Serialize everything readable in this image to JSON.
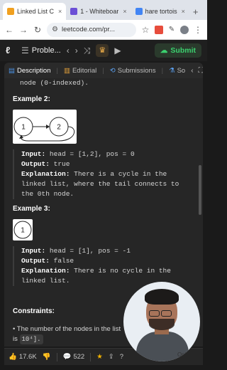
{
  "browser": {
    "tabs": [
      {
        "label": "Linked List C",
        "favicon_color": "#f0a020",
        "active": true
      },
      {
        "label": "1 - Whiteboar",
        "favicon_color": "#6b4fd6",
        "active": false
      },
      {
        "label": "hare tortois",
        "favicon_color": "#4285f4",
        "active": false
      }
    ],
    "tab_close": "×",
    "new_tab": "+",
    "address": {
      "url": "leetcode.com/pr...",
      "back": "←",
      "forward": "→",
      "reload": "↻",
      "star": "☆",
      "menu": "⋮"
    }
  },
  "leetcode": {
    "problem_list_label": "Proble...",
    "prev": "‹",
    "next": "›",
    "shuffle": "⤨",
    "run": "▶",
    "submit_label": "Submit",
    "submit_color": "#3bd16f"
  },
  "panel": {
    "tabs": [
      {
        "label": "Description",
        "icon": "description-icon",
        "active": true
      },
      {
        "label": "Editorial",
        "icon": "editorial-icon",
        "active": false
      },
      {
        "label": "Submissions",
        "icon": "submissions-icon",
        "active": false
      },
      {
        "label": "So",
        "icon": "solutions-icon",
        "active": false
      }
    ]
  },
  "content": {
    "continuation": "node (0-indexed).",
    "example2": {
      "heading": "Example 2:",
      "nodes": [
        "1",
        "2"
      ],
      "input_label": "Input:",
      "input_value": "head = [1,2], pos = 0",
      "output_label": "Output:",
      "output_value": "true",
      "explanation_label": "Explanation:",
      "explanation_value": "There is a cycle in the linked list, where the tail connects to the 0th node."
    },
    "example3": {
      "heading": "Example 3:",
      "nodes": [
        "1"
      ],
      "input_label": "Input:",
      "input_value": "head = [1], pos = -1",
      "output_label": "Output:",
      "output_value": "false",
      "explanation_label": "Explanation:",
      "explanation_value": "There is no cycle in the linked list."
    },
    "constraints": {
      "heading": "Constraints:",
      "bullet_text": "The number of the nodes in the list is",
      "bullet_range": "10⁴]."
    }
  },
  "bottom": {
    "likes": "17.6K",
    "comments": "522"
  },
  "webcam": {
    "label": "Online"
  }
}
